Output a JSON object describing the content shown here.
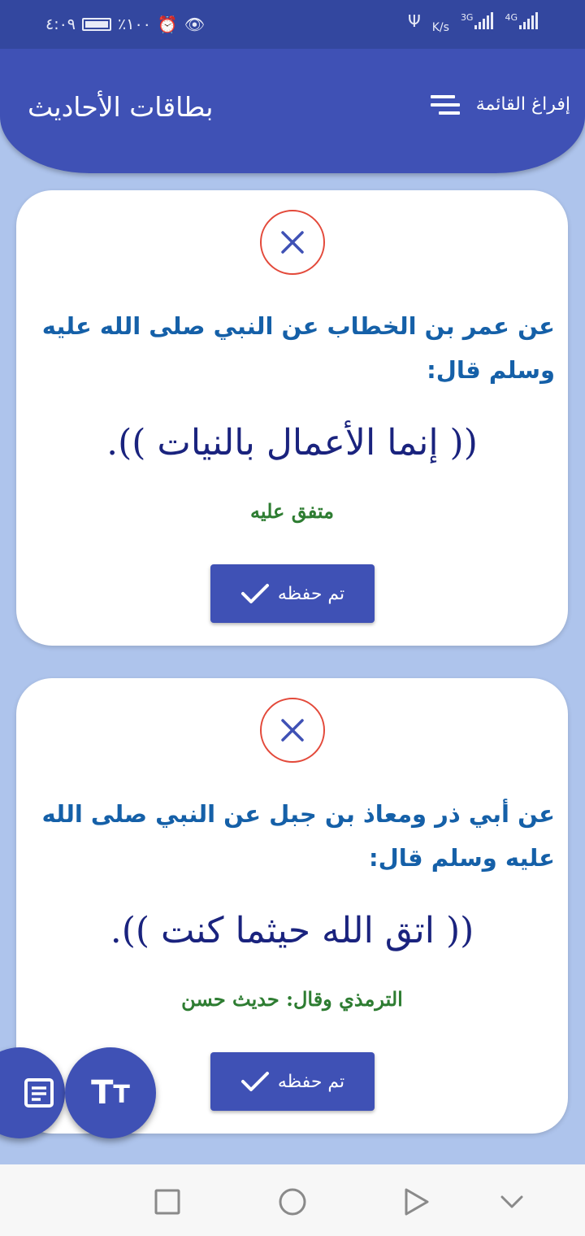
{
  "status_bar": {
    "time": "٤:٠٩",
    "battery": "٪١٠٠",
    "speed_unit": "K/s",
    "net1": "3G",
    "net2": "4G"
  },
  "app_bar": {
    "title": "بطاقات الأحاديث",
    "clear_list_label": "إفراغ القائمة"
  },
  "cards": [
    {
      "narrator": "عن عمر بن الخطاب عن النبي صلى الله عليه وسلم قال:",
      "hadith": "(( إنما الأعمال بالنيات )).",
      "source": "متفق عليه",
      "memorized_label": "تم حفظه"
    },
    {
      "narrator": "عن أبي ذر ومعاذ بن جبل عن النبي صلى الله عليه وسلم قال:",
      "hadith": "(( اتق الله حيثما كنت )).",
      "source": "الترمذي وقال: حديث حسن",
      "memorized_label": "تم حفظه"
    }
  ],
  "fabs": {
    "text_size_glyph_big": "T",
    "text_size_glyph_small": "T"
  },
  "colors": {
    "primary": "#3f51b5",
    "background": "#aec4ec",
    "narrator_text": "#1560a8",
    "hadith_text": "#1a237e",
    "source_text": "#2e7d32",
    "close_ring": "#e3493a"
  },
  "icons": {
    "close": "close-icon",
    "check": "check-icon",
    "sort": "sort-icon",
    "notes": "notes-icon",
    "text_size": "text-size-icon"
  }
}
